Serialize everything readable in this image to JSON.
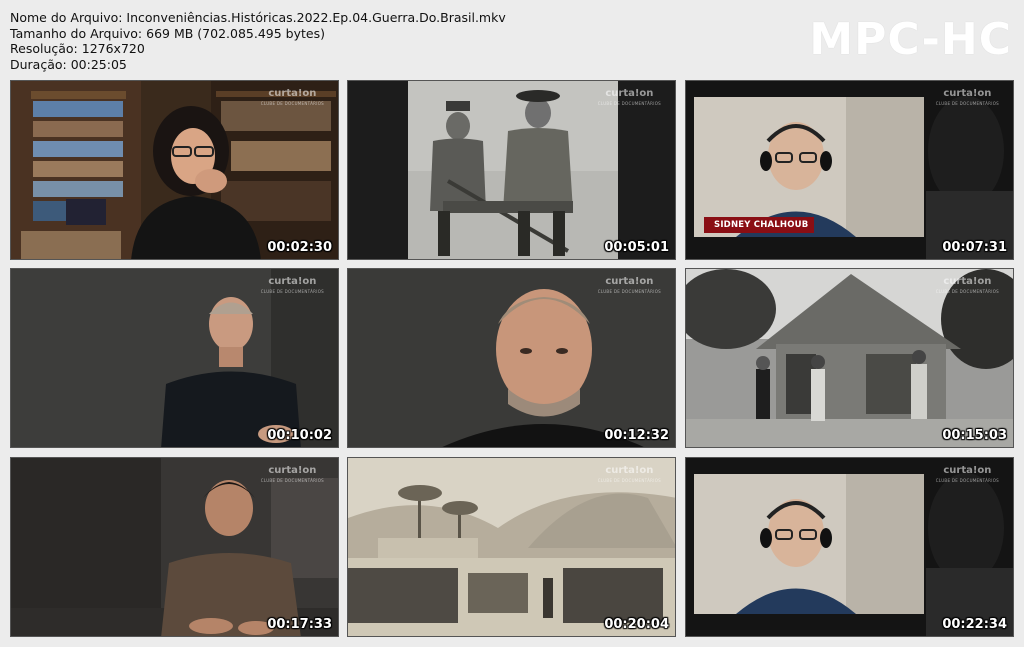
{
  "file_info": {
    "name": "Nome do Arquivo: Inconveniências.Históricas.2022.Ep.04.Guerra.Do.Brasil.mkv",
    "size": "Tamanho do Arquivo: 669 MB (702.085.495 bytes)",
    "resolution": "Resolução: 1276x720",
    "duration": "Duração: 00:25:05"
  },
  "brand": "MPC-HC",
  "thumbnails": [
    {
      "timecode": "00:02:30",
      "scene": "woman-bookshelf"
    },
    {
      "timecode": "00:05:01",
      "scene": "historic-soldiers-photo"
    },
    {
      "timecode": "00:07:31",
      "scene": "video-call-man",
      "lower_third": "SIDNEY CHALHOUB"
    },
    {
      "timecode": "00:10:02",
      "scene": "man-interview-wide"
    },
    {
      "timecode": "00:12:32",
      "scene": "man-interview-closeup"
    },
    {
      "timecode": "00:15:03",
      "scene": "historic-hut-photo"
    },
    {
      "timecode": "00:17:33",
      "scene": "man-reading"
    },
    {
      "timecode": "00:20:04",
      "scene": "historic-engraving-troops"
    },
    {
      "timecode": "00:22:34",
      "scene": "video-call-man"
    }
  ],
  "channel_logo": {
    "text": "curta!on",
    "sub": "CLUBE DE DOCUMENTÁRIOS"
  }
}
